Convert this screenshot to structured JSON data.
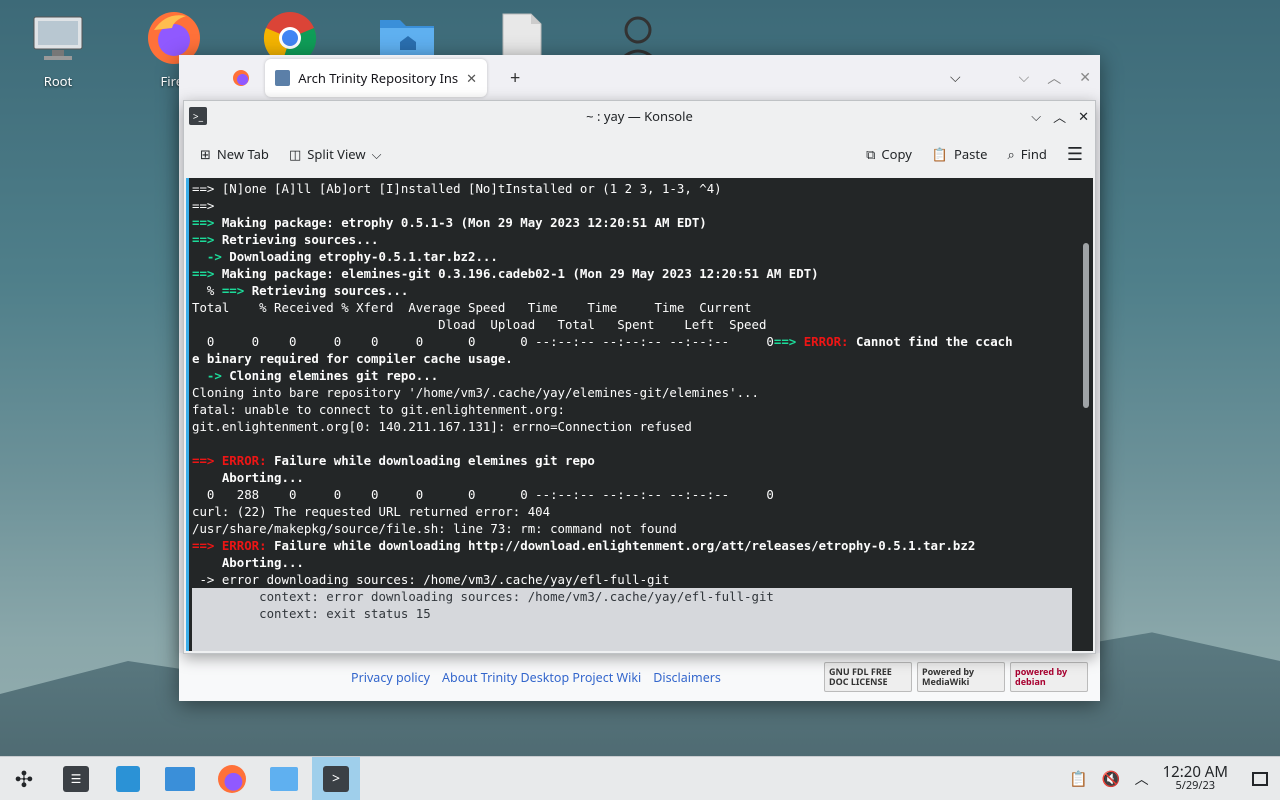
{
  "desktop": {
    "icons": [
      {
        "label": "Root"
      },
      {
        "label": "Firef"
      },
      {
        "label": ""
      },
      {
        "label": ""
      },
      {
        "label": ""
      },
      {
        "label": ""
      }
    ]
  },
  "browser": {
    "tab_title": "Arch Trinity Repository Ins",
    "new_tab_symbol": "+",
    "footer_links": [
      "Privacy policy",
      "About Trinity Desktop Project Wiki",
      "Disclaimers"
    ],
    "badges": [
      "GNU FDL FREE DOC LICENSE",
      "Powered by MediaWiki",
      "powered by debian"
    ]
  },
  "konsole": {
    "title": "~ : yay — Konsole",
    "toolbar": {
      "new_tab": "New Tab",
      "split_view": "Split View",
      "copy": "Copy",
      "paste": "Paste",
      "find": "Find"
    },
    "lines": [
      [
        [
          "n",
          "==> [N]one [A]ll [Ab]ort [I]nstalled [No]tInstalled or (1 2 3, 1-3, ^4)"
        ]
      ],
      [
        [
          "n",
          "==>"
        ]
      ],
      [
        [
          "g",
          "==>"
        ],
        [
          "b",
          " Making package: etrophy 0.5.1-3 (Mon 29 May 2023 12:20:51 AM EDT)"
        ]
      ],
      [
        [
          "g",
          "==>"
        ],
        [
          "b",
          " Retrieving sources..."
        ]
      ],
      [
        [
          "g",
          "  ->"
        ],
        [
          "b",
          " Downloading etrophy-0.5.1.tar.bz2..."
        ]
      ],
      [
        [
          "g",
          "==>"
        ],
        [
          "b",
          " Making package: elemines-git 0.3.196.cadeb02-1 (Mon 29 May 2023 12:20:51 AM EDT)"
        ]
      ],
      [
        [
          "n",
          "  % "
        ],
        [
          "g",
          "==>"
        ],
        [
          "b",
          " Retrieving sources..."
        ]
      ],
      [
        [
          "n",
          "Total    % Received % Xferd  Average Speed   Time    Time     Time  Current"
        ]
      ],
      [
        [
          "n",
          "                                 Dload  Upload   Total   Spent    Left  Speed"
        ]
      ],
      [
        [
          "n",
          "  0     0    0     0    0     0      0      0 --:--:-- --:--:-- --:--:--     0"
        ],
        [
          "g",
          "==>"
        ],
        [
          "r",
          " ERROR:"
        ],
        [
          "b",
          " Cannot find the ccach"
        ]
      ],
      [
        [
          "b",
          "e binary required for compiler cache usage."
        ]
      ],
      [
        [
          "g",
          "  ->"
        ],
        [
          "b",
          " Cloning elemines git repo..."
        ]
      ],
      [
        [
          "n",
          "Cloning into bare repository '/home/vm3/.cache/yay/elemines-git/elemines'..."
        ]
      ],
      [
        [
          "n",
          "fatal: unable to connect to git.enlightenment.org:"
        ]
      ],
      [
        [
          "n",
          "git.enlightenment.org[0: 140.211.167.131]: errno=Connection refused"
        ]
      ],
      [
        [
          "n",
          ""
        ]
      ],
      [
        [
          "r",
          "==> ERROR:"
        ],
        [
          "b",
          " Failure while downloading elemines git repo"
        ]
      ],
      [
        [
          "b",
          "    Aborting..."
        ]
      ],
      [
        [
          "n",
          "  0   288    0     0    0     0      0      0 --:--:-- --:--:-- --:--:--     0"
        ]
      ],
      [
        [
          "n",
          "curl: (22) The requested URL returned error: 404"
        ]
      ],
      [
        [
          "n",
          "/usr/share/makepkg/source/file.sh: line 73: rm: command not found"
        ]
      ],
      [
        [
          "r",
          "==> ERROR:"
        ],
        [
          "b",
          " Failure while downloading http://download.enlightenment.org/att/releases/etrophy-0.5.1.tar.bz2"
        ]
      ],
      [
        [
          "b",
          "    Aborting..."
        ]
      ],
      [
        [
          "n",
          " -> error downloading sources: /home/vm3/.cache/yay/efl-full-git"
        ]
      ],
      [
        [
          "n",
          "         context: error downloading sources: /home/vm3/.cache/yay/efl-full-git"
        ]
      ],
      [
        [
          "n",
          "         context: exit status 15"
        ]
      ]
    ],
    "selected_from": 24
  },
  "taskbar": {
    "clock_time": "12:20 AM",
    "clock_date": "5/29/23"
  },
  "colors": {
    "terminal_bg": "#232627",
    "prompt_green": "#1cdc9a",
    "error_red": "#ed1515",
    "accent_blue": "#3daee9"
  }
}
